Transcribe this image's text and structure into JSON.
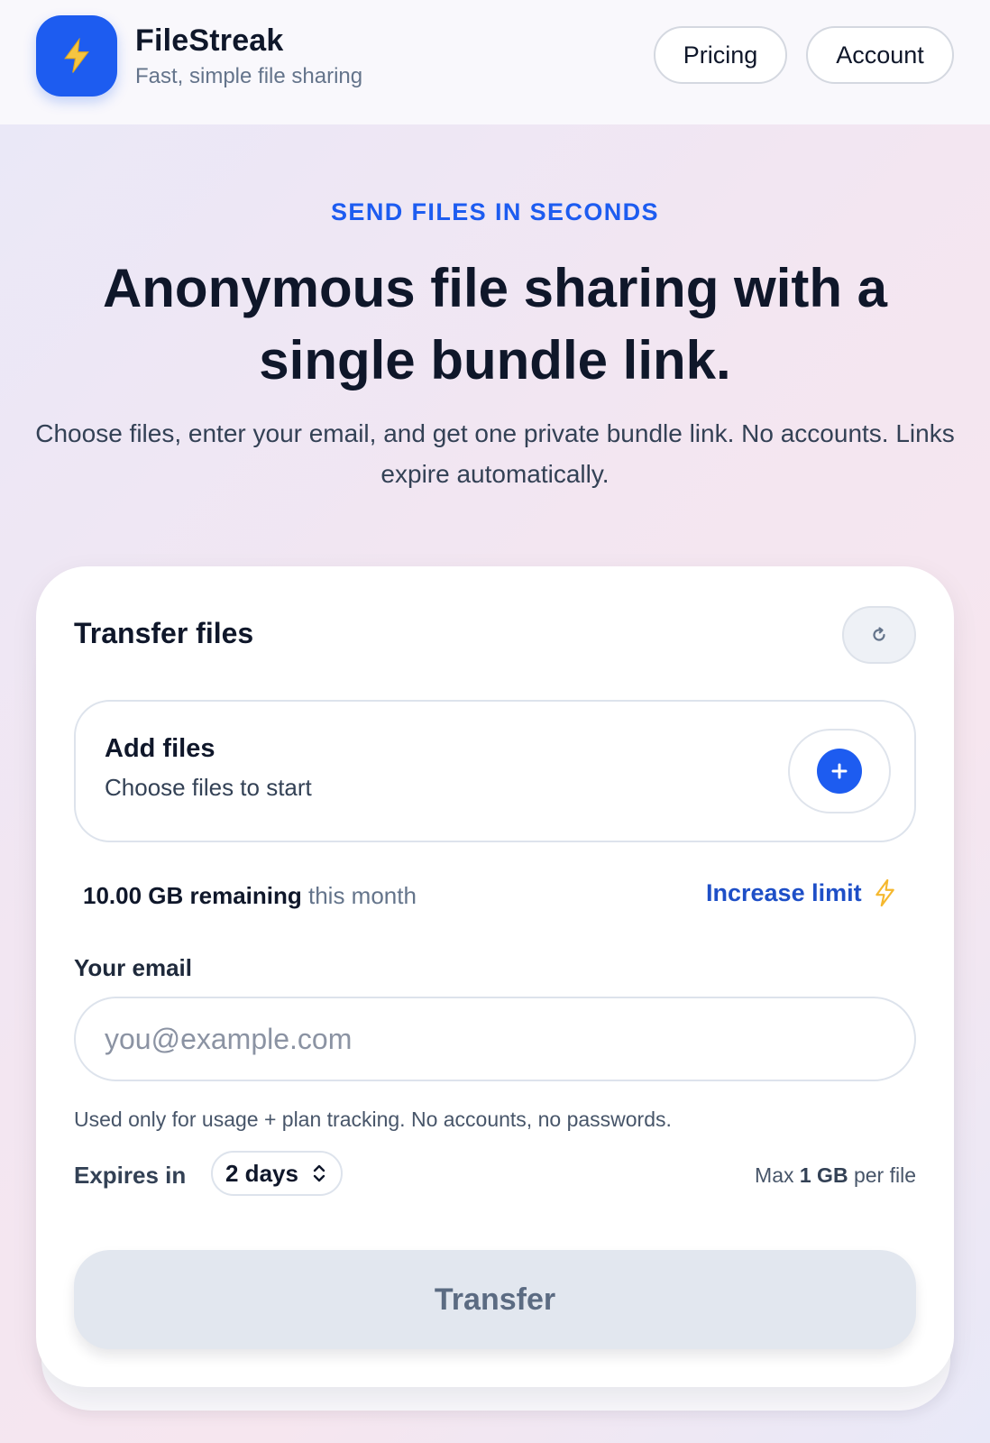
{
  "header": {
    "brand_name": "FileStreak",
    "brand_tagline": "Fast, simple file sharing",
    "logo_icon": "lightning-bolt-icon",
    "nav": {
      "pricing_label": "Pricing",
      "account_label": "Account"
    }
  },
  "hero": {
    "eyebrow": "SEND FILES IN SECONDS",
    "headline": "Anonymous file sharing with a single bundle link.",
    "subhead": "Choose files, enter your email, and get one private bundle link. No accounts. Links expire automatically."
  },
  "card": {
    "title": "Transfer files",
    "refresh_icon": "refresh-icon",
    "add_files": {
      "title": "Add files",
      "subtitle": "Choose files to start",
      "button_icon": "plus-icon"
    },
    "quota": {
      "amount": "10.00 GB remaining",
      "suffix": "this month",
      "increase_label": "Increase limit",
      "increase_icon": "lightning-bolt-icon"
    },
    "email": {
      "label": "Your email",
      "placeholder": "you@example.com",
      "value": "",
      "help": "Used only for usage + plan tracking. No accounts, no passwords."
    },
    "expires": {
      "label": "Expires in",
      "selected": "2 days"
    },
    "max_size": {
      "prefix": "Max",
      "value": "1 GB",
      "suffix": "per file"
    },
    "transfer_label": "Transfer"
  },
  "colors": {
    "accent": "#1d5cf0",
    "link": "#1e4fc7",
    "bolt": "#f5b82e",
    "text": "#0f172a"
  }
}
